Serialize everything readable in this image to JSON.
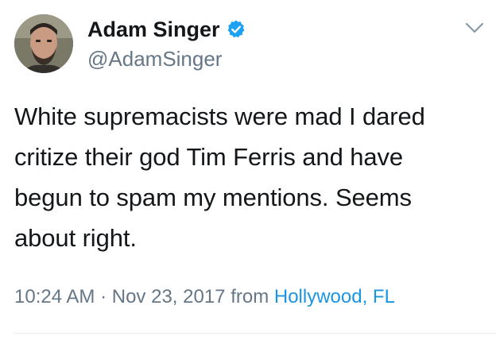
{
  "user": {
    "display_name": "Adam Singer",
    "handle": "@AdamSinger",
    "verified": true,
    "avatar_icon": "profile-photo"
  },
  "tweet": {
    "lines": [
      "White supremacists were mad I dared",
      "critize their god Tim Ferris and have",
      "begun to spam my mentions. Seems",
      "about right."
    ]
  },
  "meta": {
    "time": "10:24 AM",
    "separator": "·",
    "date": "Nov 23, 2017",
    "from_label": "from",
    "location": "Hollywood, FL"
  },
  "colors": {
    "link": "#1b95e0",
    "secondary_text": "#657786",
    "primary_text": "#14171a",
    "verified_badge": "#1da1f2"
  },
  "icons": {
    "verified": "verified-badge-icon",
    "menu": "chevron-down-icon"
  }
}
